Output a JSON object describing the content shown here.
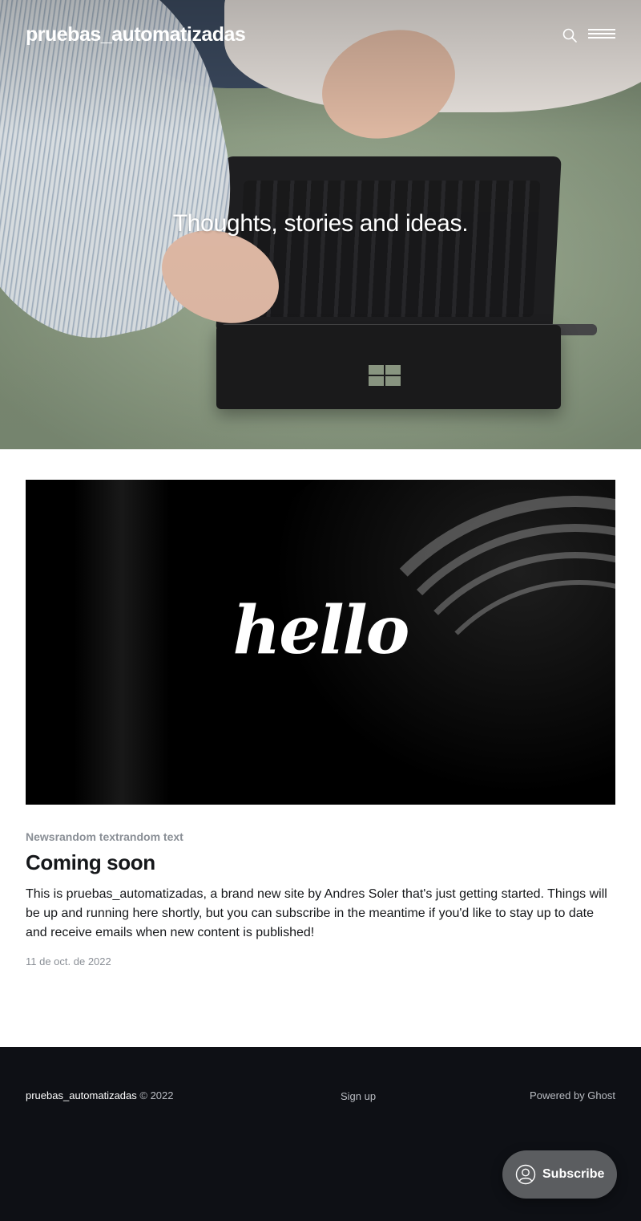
{
  "header": {
    "site_title": "pruebas_automatizadas",
    "search_icon": "search-icon",
    "menu_icon": "hamburger-menu-icon"
  },
  "hero": {
    "tagline": "Thoughts, stories and ideas."
  },
  "post": {
    "image_text": "hello",
    "tag": "Newsrandom textrandom text",
    "title": "Coming soon",
    "excerpt": "This is pruebas_automatizadas, a brand new site by Andres Soler that's just getting started. Things will be up and running here shortly, but you can subscribe in the meantime if you'd like to stay up to date and receive emails when new content is published!",
    "date": "11 de oct. de 2022"
  },
  "footer": {
    "site_title": "pruebas_automatizadas",
    "copyright": "© 2022",
    "nav_signup": "Sign up",
    "powered_by": "Powered by Ghost"
  },
  "portal": {
    "subscribe_label": "Subscribe",
    "icon": "user-circle-icon"
  },
  "colors": {
    "footer_bg": "#0e1015",
    "subscribe_bg": "#5b5d60",
    "meta_gray": "#8a8f96"
  }
}
